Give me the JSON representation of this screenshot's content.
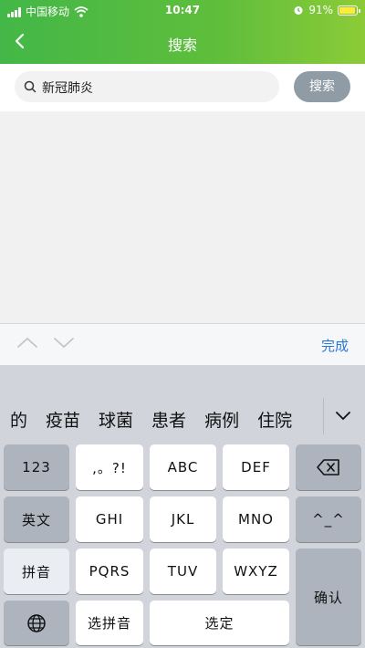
{
  "status_bar": {
    "carrier": "中国移动",
    "time": "10:47",
    "battery": "91%"
  },
  "nav": {
    "title": "搜索"
  },
  "search": {
    "value": "新冠肺炎",
    "button_label": "搜索"
  },
  "accessory": {
    "done_label": "完成"
  },
  "keyboard": {
    "candidates": [
      "的",
      "疫苗",
      "球菌",
      "患者",
      "病例",
      "住院"
    ],
    "keys": {
      "num": "123",
      "punct": ",。?!",
      "abc": "ABC",
      "def": "DEF",
      "en": "英文",
      "ghi": "GHI",
      "jkl": "JKL",
      "mno": "MNO",
      "emoticon": "^_^",
      "pinyin": "拼音",
      "pqrs": "PQRS",
      "tuv": "TUV",
      "wxyz": "WXYZ",
      "confirm": "确认",
      "select_pinyin": "选拼音",
      "select": "选定"
    }
  },
  "colors": {
    "header_green": "#43b747",
    "search_button": "#8f9ca6",
    "done_blue": "#2a77d8",
    "battery_fill": "#ffeb3b"
  }
}
